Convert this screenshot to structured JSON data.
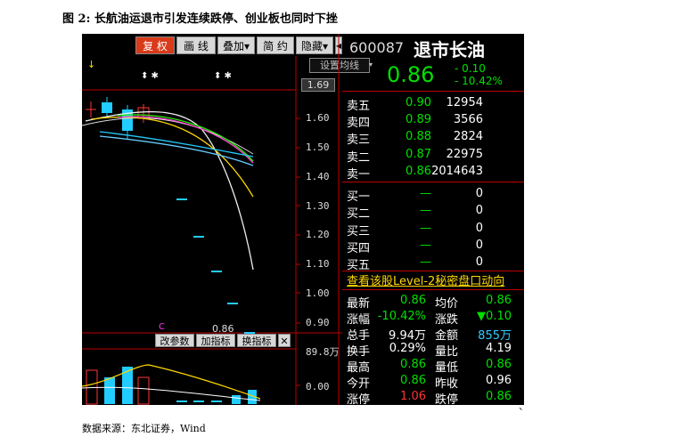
{
  "caption": "图 2:  长航油运退市引发连续跌停、创业板也同时下挫",
  "source": "数据来源：东北证券，Wind",
  "toolbar": {
    "restore": "复 权",
    "draw": "画 线",
    "overlay": "叠加▾",
    "simple": "简 约",
    "hide": "隐藏▾",
    "scroll_left": "◀",
    "scroll_right": "▶"
  },
  "kline": {
    "settings": "设置均线",
    "settings_drop": "▾",
    "arrow_down": "↓",
    "markers": "⬍ ✱",
    "current_price": "1.69",
    "y_ticks": [
      "1.60",
      "1.50",
      "1.40",
      "1.30",
      "1.20",
      "1.10",
      "1.00",
      "0.90"
    ],
    "last_low": "0.86",
    "event_mark": "C"
  },
  "sub": {
    "change_param": "改参数",
    "add_indicator": "加指标",
    "swap_indicator": "换指标",
    "close": "✕",
    "top_value": "89.8万",
    "bottom_value": "0.00"
  },
  "quote": {
    "code": "600087",
    "name": "退市长油",
    "price": "0.86",
    "change": "- 0.10",
    "change_pct": "- 10.42%",
    "asks": [
      {
        "label": "卖五",
        "price": "0.90",
        "vol": "12954"
      },
      {
        "label": "卖四",
        "price": "0.89",
        "vol": "3566"
      },
      {
        "label": "卖三",
        "price": "0.88",
        "vol": "2824"
      },
      {
        "label": "卖二",
        "price": "0.87",
        "vol": "22975"
      },
      {
        "label": "卖一",
        "price": "0.86",
        "vol": "2014643"
      }
    ],
    "bids": [
      {
        "label": "买一",
        "price": "—",
        "vol": "0"
      },
      {
        "label": "买二",
        "price": "—",
        "vol": "0"
      },
      {
        "label": "买三",
        "price": "—",
        "vol": "0"
      },
      {
        "label": "买四",
        "price": "—",
        "vol": "0"
      },
      {
        "label": "买五",
        "price": "—",
        "vol": "0"
      }
    ],
    "level2_link": "查看该股Level-2秘密盘口动向",
    "stats": [
      {
        "l1": "最新",
        "v1": "0.86",
        "l2": "均价",
        "v2": "0.86"
      },
      {
        "l1": "涨幅",
        "v1": "-10.42%",
        "l2": "涨跌",
        "v2": "▼0.10"
      },
      {
        "l1": "总手",
        "v1": "9.94万",
        "l2": "金额",
        "v2": "855万"
      },
      {
        "l1": "换手",
        "v1": "0.29%",
        "l2": "量比",
        "v2": "4.19"
      },
      {
        "l1": "最高",
        "v1": "0.86",
        "l2": "量低",
        "v2": "0.86"
      },
      {
        "l1": "今开",
        "v1": "0.86",
        "l2": "昨收",
        "v2": "0.96"
      },
      {
        "l1": "涨停",
        "v1": "1.06",
        "l2": "跌停",
        "v2": "0.86"
      }
    ]
  },
  "edge_mark": "、"
}
